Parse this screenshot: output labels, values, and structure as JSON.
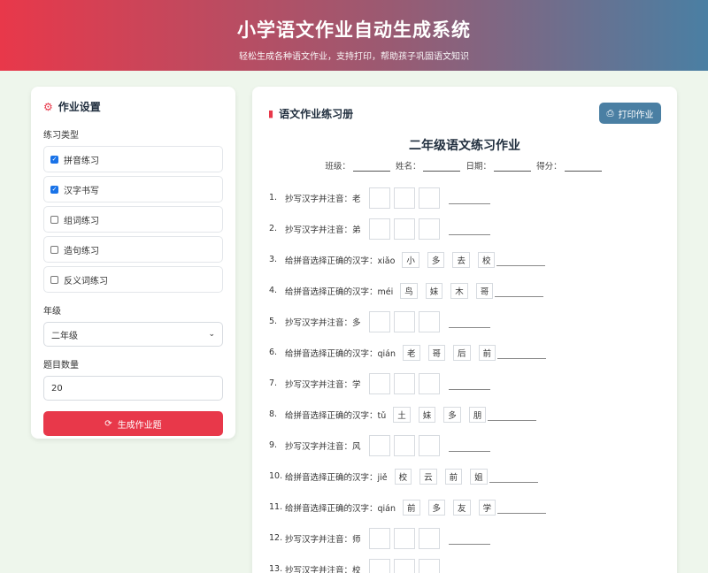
{
  "header": {
    "title": "小学语文作业自动生成系统",
    "subtitle": "轻松生成各种语文作业，支持打印，帮助孩子巩固语文知识"
  },
  "settings": {
    "title": "作业设置",
    "type_label": "练习类型",
    "types": [
      {
        "label": "拼音练习",
        "checked": true
      },
      {
        "label": "汉字书写",
        "checked": true
      },
      {
        "label": "组词练习",
        "checked": false
      },
      {
        "label": "造句练习",
        "checked": false
      },
      {
        "label": "反义词练习",
        "checked": false
      }
    ],
    "grade_label": "年级",
    "grade_value": "二年级",
    "count_label": "题目数量",
    "count_value": "20",
    "generate_label": "生成作业题"
  },
  "worksheet": {
    "title": "语文作业练习册",
    "print_label": "打印作业",
    "sheet_title": "二年级语文练习作业",
    "meta": [
      "班级：",
      "姓名：",
      "日期：",
      "得分："
    ]
  },
  "questions": [
    {
      "num": "1.",
      "type": "copy",
      "text": "抄写汉字并注音：老"
    },
    {
      "num": "2.",
      "type": "copy",
      "text": "抄写汉字并注音：弟"
    },
    {
      "num": "3.",
      "type": "choose",
      "text": "给拼音选择正确的汉字：xiǎo",
      "options": [
        "小",
        "多",
        "去",
        "校"
      ]
    },
    {
      "num": "4.",
      "type": "choose",
      "text": "给拼音选择正确的汉字：méi",
      "options": [
        "鸟",
        "妹",
        "木",
        "哥"
      ]
    },
    {
      "num": "5.",
      "type": "copy",
      "text": "抄写汉字并注音：多"
    },
    {
      "num": "6.",
      "type": "choose",
      "text": "给拼音选择正确的汉字：qián",
      "options": [
        "老",
        "哥",
        "后",
        "前"
      ]
    },
    {
      "num": "7.",
      "type": "copy",
      "text": "抄写汉字并注音：学"
    },
    {
      "num": "8.",
      "type": "choose",
      "text": "给拼音选择正确的汉字：tǔ",
      "options": [
        "土",
        "妹",
        "多",
        "朋"
      ]
    },
    {
      "num": "9.",
      "type": "copy",
      "text": "抄写汉字并注音：风"
    },
    {
      "num": "10.",
      "type": "choose",
      "text": "给拼音选择正确的汉字：jiě",
      "options": [
        "校",
        "云",
        "前",
        "姐"
      ]
    },
    {
      "num": "11.",
      "type": "choose",
      "text": "给拼音选择正确的汉字：qián",
      "options": [
        "前",
        "多",
        "友",
        "学"
      ]
    },
    {
      "num": "12.",
      "type": "copy",
      "text": "抄写汉字并注音：师"
    },
    {
      "num": "13.",
      "type": "copy",
      "text": "抄写汉字并注音：校"
    }
  ]
}
